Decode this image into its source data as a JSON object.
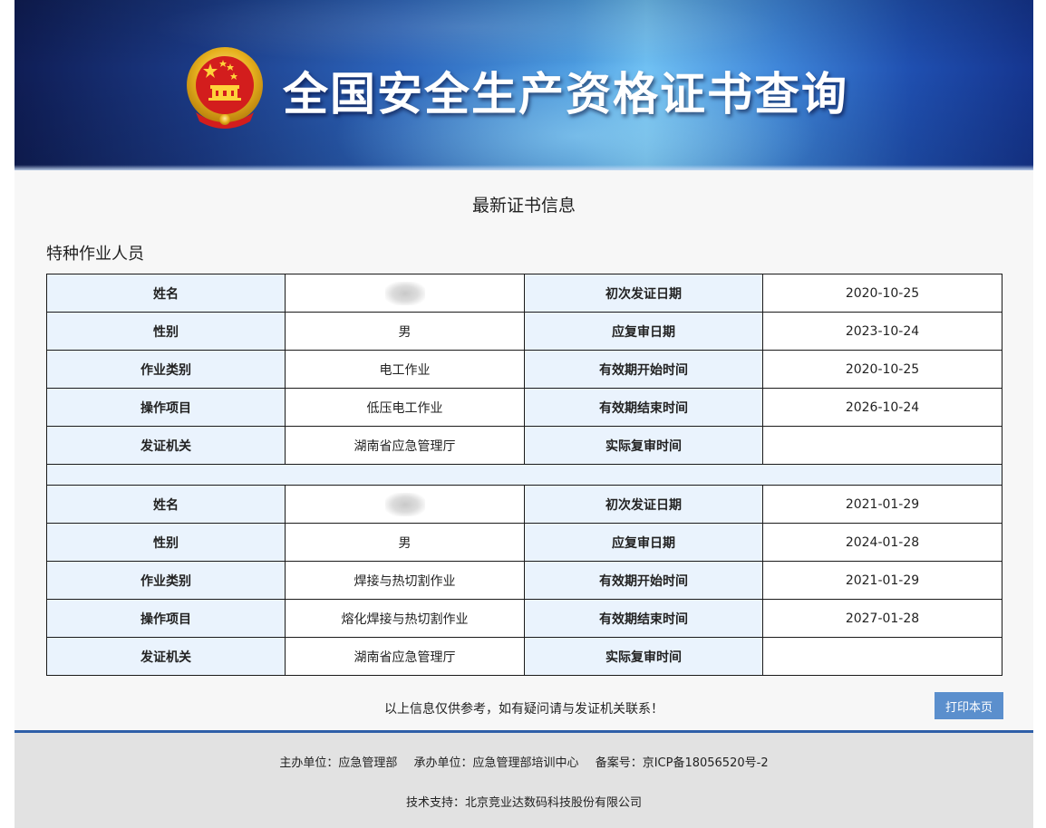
{
  "header": {
    "title": "全国安全生产资格证书查询"
  },
  "section_title": "最新证书信息",
  "category_title": "特种作业人员",
  "labels": {
    "name": "姓名",
    "gender": "性别",
    "job_type": "作业类别",
    "operation_item": "操作项目",
    "issuer": "发证机关",
    "first_issue_date": "初次发证日期",
    "review_due_date": "应复审日期",
    "valid_start": "有效期开始时间",
    "valid_end": "有效期结束时间",
    "actual_review": "实际复审时间"
  },
  "records": [
    {
      "name": "",
      "gender": "男",
      "job_type": "电工作业",
      "operation_item": "低压电工作业",
      "issuer": "湖南省应急管理厅",
      "first_issue_date": "2020-10-25",
      "review_due_date": "2023-10-24",
      "valid_start": "2020-10-25",
      "valid_end": "2026-10-24",
      "actual_review": ""
    },
    {
      "name": "",
      "gender": "男",
      "job_type": "焊接与热切割作业",
      "operation_item": "熔化焊接与热切割作业",
      "issuer": "湖南省应急管理厅",
      "first_issue_date": "2021-01-29",
      "review_due_date": "2024-01-28",
      "valid_start": "2021-01-29",
      "valid_end": "2027-01-28",
      "actual_review": ""
    }
  ],
  "notice": "以上信息仅供参考，如有疑问请与发证机关联系！",
  "print_button": "打印本页",
  "footer": {
    "sponsor": "主办单位：应急管理部",
    "organizer": "承办单位：应急管理部培训中心",
    "icp": "备案号：京ICP备18056520号-2",
    "tech_support": "技术支持：北京竞业达数码科技股份有限公司"
  },
  "colors": {
    "label_bg": "#eaf3fd",
    "button_bg": "#5b8fcd",
    "footer_border": "#2f5fa8",
    "footer_bg": "#e2e2e2"
  }
}
